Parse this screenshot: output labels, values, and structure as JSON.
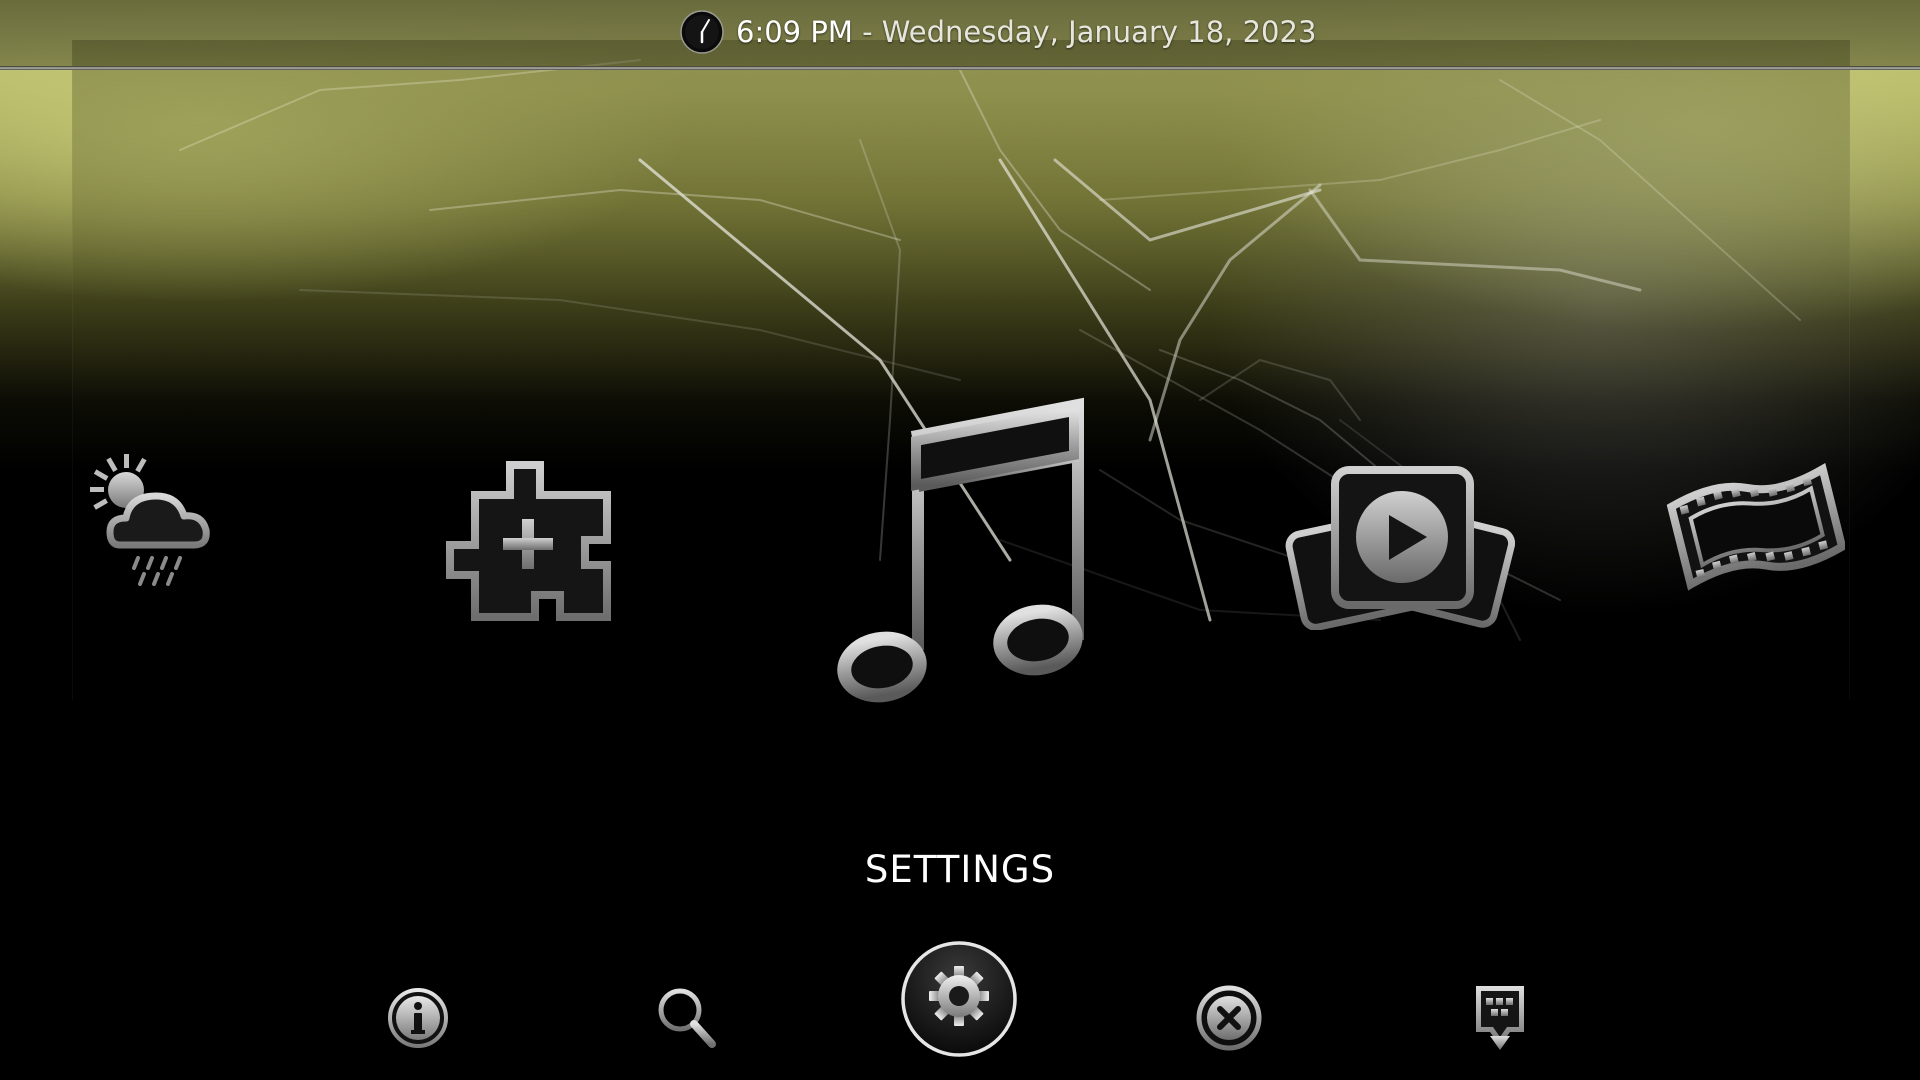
{
  "header": {
    "time": "6:09 PM",
    "separator": "-",
    "date": "Wednesday, January 18, 2023"
  },
  "main_menu": {
    "items": [
      {
        "id": "weather",
        "icon": "weather-icon",
        "selected": false
      },
      {
        "id": "addons",
        "icon": "puzzle-plus-icon",
        "selected": false
      },
      {
        "id": "music",
        "icon": "music-note-icon",
        "selected": true
      },
      {
        "id": "videos",
        "icon": "play-icon",
        "selected": false
      },
      {
        "id": "movies",
        "icon": "film-strip-icon",
        "selected": false
      }
    ]
  },
  "focused_label": "SETTINGS",
  "bottom_bar": {
    "buttons": [
      {
        "id": "info",
        "icon": "info-icon",
        "selected": false
      },
      {
        "id": "search",
        "icon": "search-icon",
        "selected": false
      },
      {
        "id": "settings",
        "icon": "gear-icon",
        "selected": true
      },
      {
        "id": "exit",
        "icon": "close-icon",
        "selected": false
      },
      {
        "id": "favourites",
        "icon": "download-icon",
        "selected": false
      }
    ]
  },
  "colors": {
    "accent": "#ffffff",
    "background_top": "#c6c87a",
    "background_bottom": "#000000"
  }
}
